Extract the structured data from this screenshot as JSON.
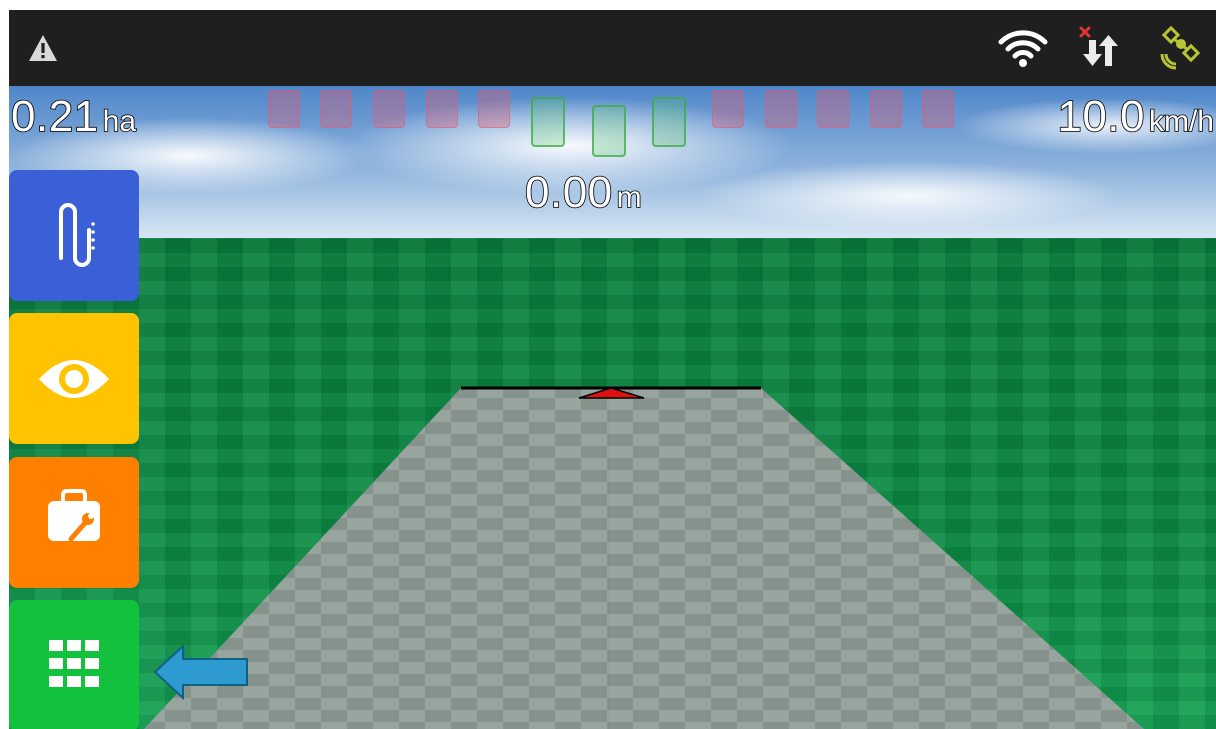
{
  "status_bar": {
    "icons": [
      "warning-icon",
      "wifi-icon",
      "data-transfer-icon",
      "gps-satellite-icon"
    ],
    "colors": {
      "background": "#1f1f1f",
      "transfer_error": "#e0342c",
      "satellite": "#b7c533"
    }
  },
  "hud": {
    "area_value": "0.21",
    "area_unit": "ha",
    "speed_value": "10.0",
    "speed_unit": "km/h",
    "offset_value": "0.00",
    "offset_unit": "m",
    "lightbar_segments": [
      "red",
      "red",
      "red",
      "red",
      "red",
      "green",
      "green",
      "green",
      "red",
      "red",
      "red",
      "red",
      "red",
      "red"
    ]
  },
  "sidebar": {
    "buttons": [
      {
        "name": "guidance-button",
        "icon": "guidance-pattern-icon",
        "color": "#3b5fd6"
      },
      {
        "name": "view-button",
        "icon": "eye-icon",
        "color": "#ffc300"
      },
      {
        "name": "tools-button",
        "icon": "toolbox-icon",
        "color": "#ff7f00"
      },
      {
        "name": "apps-button",
        "icon": "grid-icon",
        "color": "#12c23c"
      }
    ]
  },
  "annotation": {
    "icon": "pointer-arrow-icon",
    "color": "#2d9bd0"
  }
}
